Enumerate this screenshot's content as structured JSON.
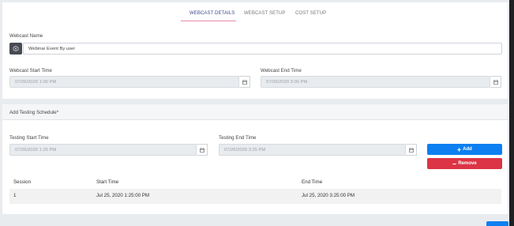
{
  "tabs": [
    "WEBCAST DETAILS",
    "WEBCAST SETUP",
    "COST SETUP"
  ],
  "webcast": {
    "name_label": "Webcast Name",
    "name_value": "Webinar Event By user",
    "start_label": "Webcast Start Time",
    "start_value": "07/26/2020 1:00 PM",
    "end_label": "Webcast End Time",
    "end_value": "07/26/2020 3:00 PM"
  },
  "testing": {
    "header": "Add Testing Schedule*",
    "start_label": "Testing Start Time",
    "start_value": "07/26/2020 1:25 PM",
    "end_label": "Testing End Time",
    "end_value": "07/26/2020 3:25 PM",
    "add_label": "Add",
    "remove_label": "Remove"
  },
  "table": {
    "headers": [
      "Session",
      "Start Time",
      "End Time"
    ],
    "rows": [
      [
        "1",
        "Jul 25, 2020 1:25:00 PM",
        "Jul 25, 2020 3:25:00 PM"
      ]
    ]
  },
  "colors": {
    "primary": "#0d7ff0",
    "danger": "#dc3545",
    "tab_active": "#3a4a8c",
    "tab_underline": "#e58ca6"
  },
  "icons": [
    "webcast-icon",
    "calendar-icon",
    "plus-icon",
    "minus-icon"
  ]
}
